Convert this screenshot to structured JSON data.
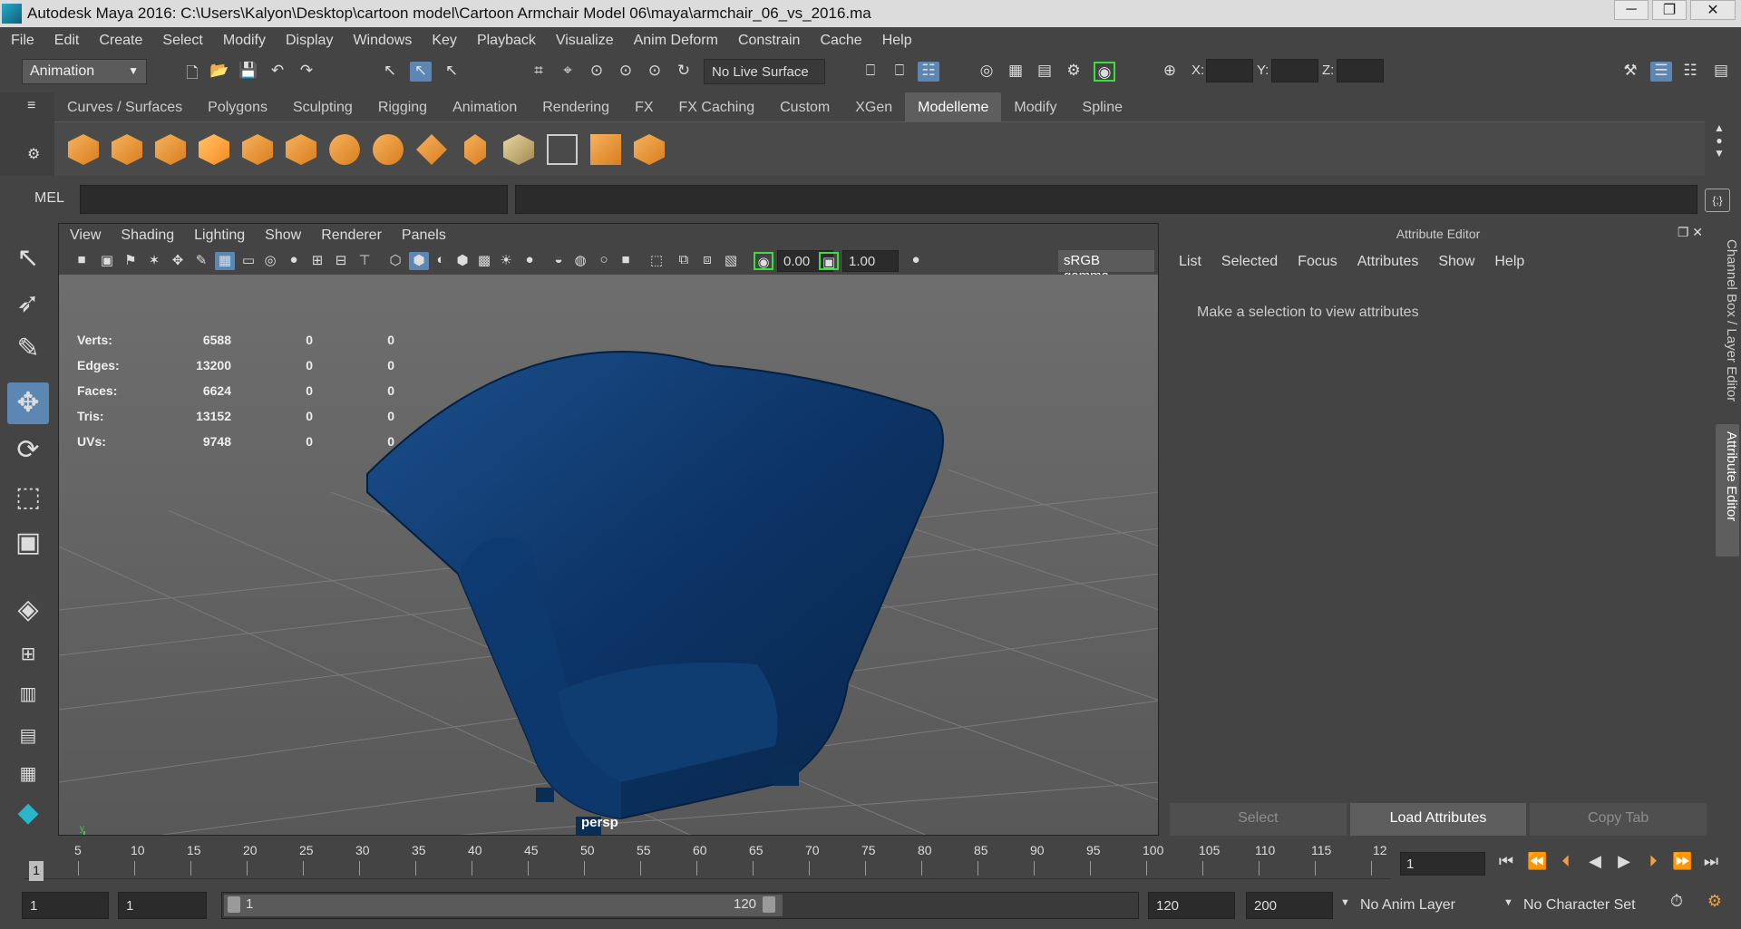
{
  "window": {
    "title": "Autodesk Maya 2016: C:\\Users\\Kalyon\\Desktop\\cartoon model\\Cartoon Armchair Model 06\\maya\\armchair_06_vs_2016.ma"
  },
  "menubar": [
    "File",
    "Edit",
    "Create",
    "Select",
    "Modify",
    "Display",
    "Windows",
    "Key",
    "Playback",
    "Visualize",
    "Anim Deform",
    "Constrain",
    "Cache",
    "Help"
  ],
  "status": {
    "mode": "Animation",
    "live_surface": "No Live Surface",
    "x_label": "X:",
    "y_label": "Y:",
    "z_label": "Z:"
  },
  "shelf": {
    "tabs": [
      "Curves / Surfaces",
      "Polygons",
      "Sculpting",
      "Rigging",
      "Animation",
      "Rendering",
      "FX",
      "FX Caching",
      "Custom",
      "XGen",
      "Modelleme",
      "Modify",
      "Spline"
    ],
    "active_tab": "Modelleme"
  },
  "command": {
    "label": "MEL"
  },
  "viewport": {
    "menu": [
      "View",
      "Shading",
      "Lighting",
      "Show",
      "Renderer",
      "Panels"
    ],
    "exposure": "0.00",
    "gamma": "1.00",
    "color_space": "sRGB gamma",
    "camera": "persp",
    "hud": [
      {
        "label": "Verts:",
        "v1": "6588",
        "v2": "0",
        "v3": "0"
      },
      {
        "label": "Edges:",
        "v1": "13200",
        "v2": "0",
        "v3": "0"
      },
      {
        "label": "Faces:",
        "v1": "6624",
        "v2": "0",
        "v3": "0"
      },
      {
        "label": "Tris:",
        "v1": "13152",
        "v2": "0",
        "v3": "0"
      },
      {
        "label": "UVs:",
        "v1": "9748",
        "v2": "0",
        "v3": "0"
      }
    ]
  },
  "attribute_editor": {
    "title": "Attribute Editor",
    "menu": [
      "List",
      "Selected",
      "Focus",
      "Attributes",
      "Show",
      "Help"
    ],
    "message": "Make a selection to view attributes",
    "buttons": {
      "select": "Select",
      "load": "Load Attributes",
      "copy": "Copy Tab"
    }
  },
  "side_tabs": {
    "channel_box": "Channel Box / Layer Editor",
    "attribute_editor": "Attribute Editor"
  },
  "timeline": {
    "ticks": [
      "5",
      "10",
      "15",
      "20",
      "25",
      "30",
      "35",
      "40",
      "45",
      "50",
      "55",
      "60",
      "65",
      "70",
      "75",
      "80",
      "85",
      "90",
      "95",
      "100",
      "105",
      "110",
      "115",
      "12"
    ],
    "current_frame": "1",
    "frame_field": "1"
  },
  "range": {
    "start": "1",
    "playback_start": "1",
    "slider_start": "1",
    "slider_end": "120",
    "playback_end": "120",
    "end": "200",
    "anim_layer": "No Anim Layer",
    "character_set": "No Character Set"
  }
}
